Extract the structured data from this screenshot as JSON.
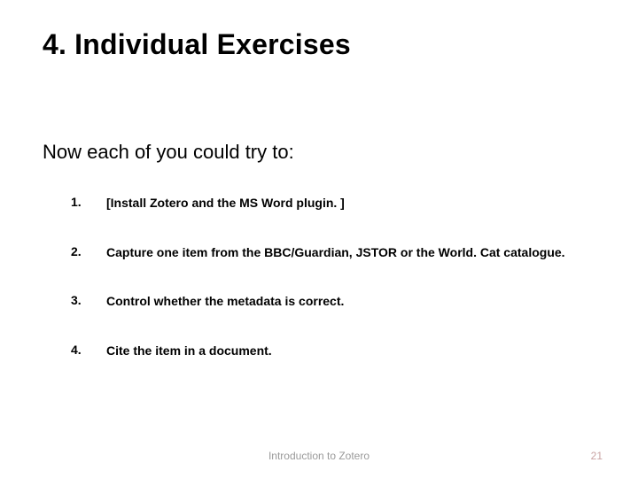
{
  "title": "4. Individual Exercises",
  "intro": "Now each of you could try to:",
  "items": [
    {
      "num": "1.",
      "text": "[Install Zotero and the MS Word plugin. ]"
    },
    {
      "num": "2.",
      "text": "Capture one item from the BBC/Guardian, JSTOR or the World. Cat catalogue."
    },
    {
      "num": "3.",
      "text": "Control whether the metadata is correct."
    },
    {
      "num": "4.",
      "text": "Cite the item in a document."
    }
  ],
  "footer": "Introduction to Zotero",
  "page": "21"
}
